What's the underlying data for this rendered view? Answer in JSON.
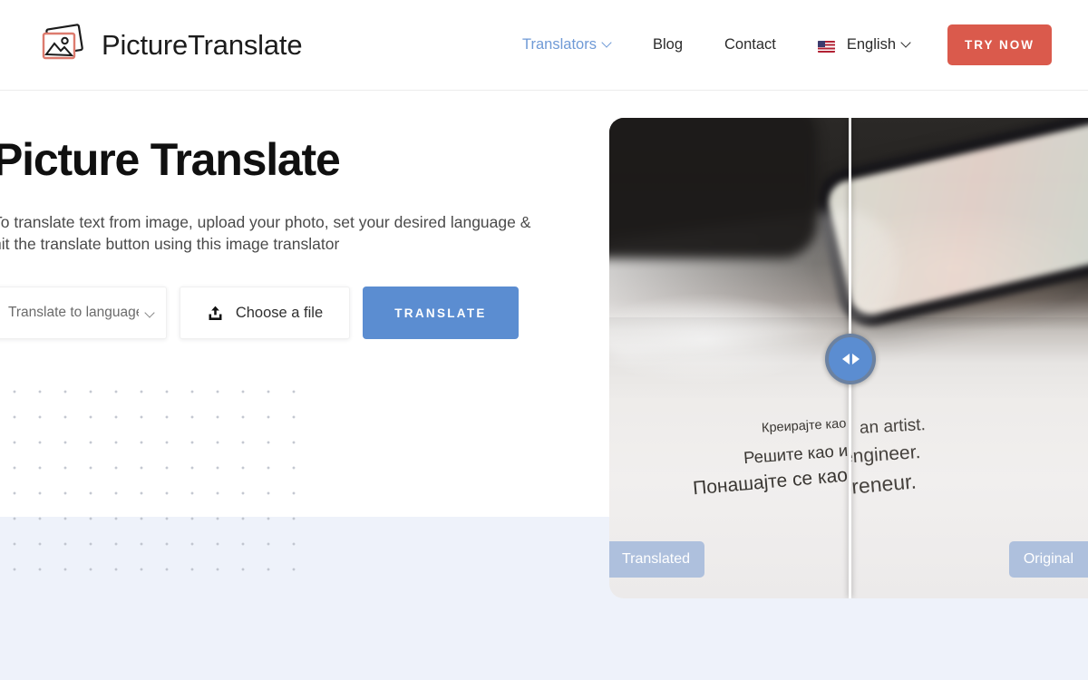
{
  "brand": {
    "name": "PictureTranslate",
    "logo_icon": "picture-frames-icon"
  },
  "header": {
    "nav": [
      {
        "label": "Translators",
        "accent": true,
        "has_chevron": true
      },
      {
        "label": "Blog",
        "accent": false,
        "has_chevron": false
      },
      {
        "label": "Contact",
        "accent": false,
        "has_chevron": false
      }
    ],
    "language": {
      "label": "English",
      "flag_icon": "us-flag-icon",
      "chevron_icon": "chevron-down-icon"
    },
    "cta": {
      "label": "TRY NOW",
      "color": "#da5a4c"
    }
  },
  "hero": {
    "title": "Picture Translate",
    "description": "To translate text from image, upload your photo, set your desired language & hit the translate button using this image translator",
    "controls": {
      "language_select": {
        "value": "Translate to language",
        "chevron_icon": "chevron-down-icon"
      },
      "file_button": {
        "label": "Choose a file",
        "icon": "upload-icon"
      },
      "translate_button": {
        "label": "TRANSLATE",
        "color": "#5b8dd1"
      }
    }
  },
  "compare": {
    "handle_icon": "left-right-arrows-icon",
    "badges": {
      "left": "Translated",
      "right": "Original"
    },
    "translated_lines": [
      "Креирајте као",
      "Решите као и",
      "Понашајте се као"
    ],
    "original_lines": [
      "an artist.",
      "engineer.",
      "repreneur."
    ]
  },
  "colors": {
    "accent_blue": "#5b8dd1",
    "nav_blue": "#6f9ad6",
    "cta_red": "#da5a4c",
    "lower_band": "#eef2fa",
    "badge_blue": "#96afd7"
  }
}
